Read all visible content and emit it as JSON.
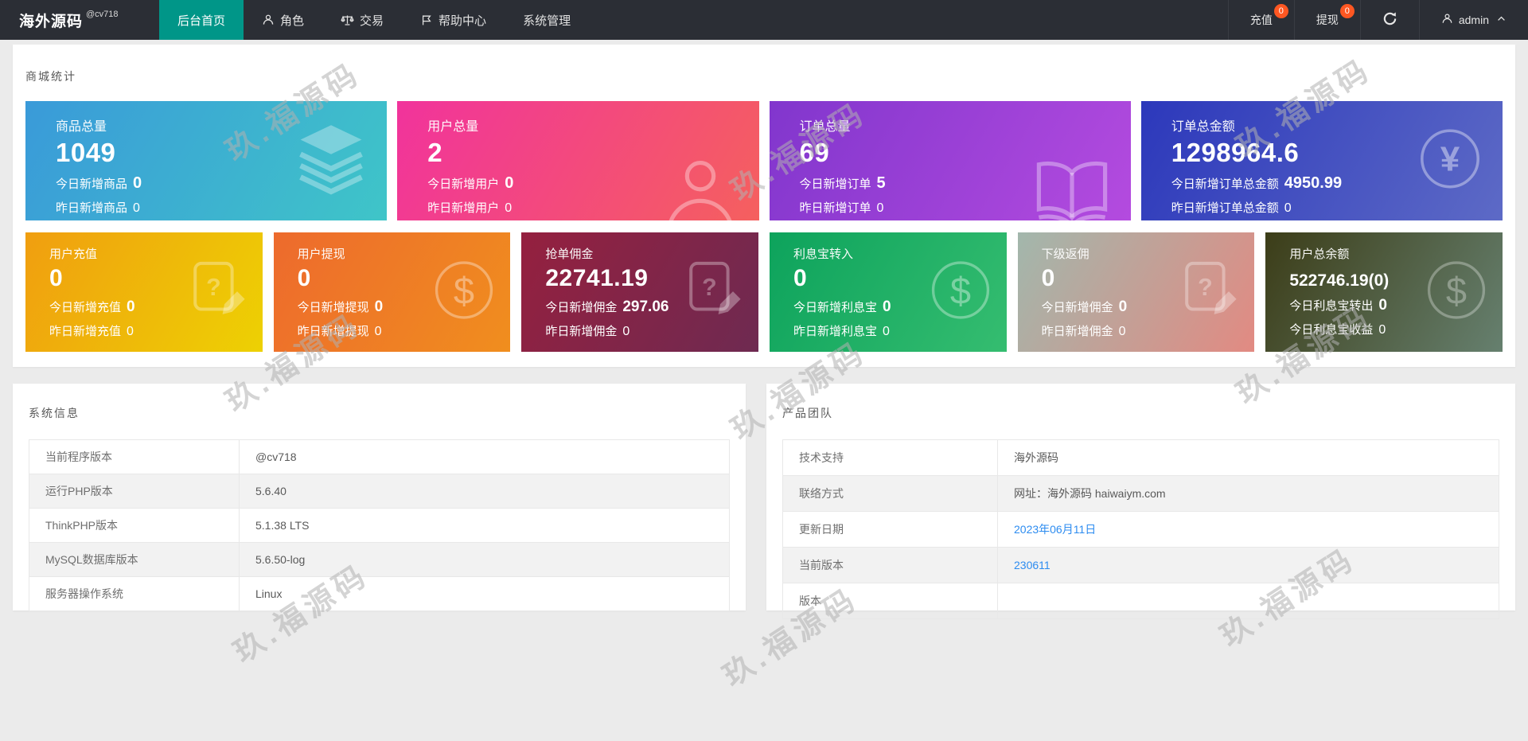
{
  "navbar": {
    "brand": "海外源码",
    "brand_sup": "@cv718",
    "menu": [
      {
        "label": "后台首页",
        "active": true
      },
      {
        "label": "角色",
        "icon": "user-icon"
      },
      {
        "label": "交易",
        "icon": "scales-icon"
      },
      {
        "label": "帮助中心",
        "icon": "flag-icon"
      },
      {
        "label": "系统管理"
      }
    ],
    "right": {
      "recharge": {
        "label": "充值",
        "badge": "0"
      },
      "withdraw": {
        "label": "提现",
        "badge": "0"
      },
      "user": {
        "name": "admin"
      }
    }
  },
  "stats": {
    "section_title": "商城统计",
    "row1": [
      {
        "title": "商品总量",
        "value": "1049",
        "today_label": "今日新增商品",
        "today_value": "0",
        "yesterday_label": "昨日新增商品",
        "yesterday_value": "0",
        "icon": "layers-icon",
        "gradient": [
          "#3a9ad9",
          "#3fc5c8"
        ]
      },
      {
        "title": "用户总量",
        "value": "2",
        "today_label": "今日新增用户",
        "today_value": "0",
        "yesterday_label": "昨日新增用户",
        "yesterday_value": "0",
        "icon": "person-icon",
        "gradient": [
          "#f1339c",
          "#f5605e"
        ]
      },
      {
        "title": "订单总量",
        "value": "69",
        "today_label": "今日新增订单",
        "today_value": "5",
        "yesterday_label": "昨日新增订单",
        "yesterday_value": "0",
        "icon": "book-icon",
        "gradient": [
          "#8136cd",
          "#b44bdf"
        ]
      },
      {
        "title": "订单总金额",
        "value": "1298964.6",
        "today_label": "今日新增订单总金额",
        "today_value": "4950.99",
        "yesterday_label": "昨日新增订单总金额",
        "yesterday_value": "0",
        "icon": "yen-icon",
        "gradient": [
          "#2c38bb",
          "#5d6ac6"
        ]
      }
    ],
    "row2": [
      {
        "title": "用户充值",
        "value": "0",
        "today_label": "今日新增充值",
        "today_value": "0",
        "yesterday_label": "昨日新增充值",
        "yesterday_value": "0",
        "icon": "doc-question-icon",
        "gradient": [
          "#f09e10",
          "#edd103"
        ]
      },
      {
        "title": "用户提现",
        "value": "0",
        "today_label": "今日新增提现",
        "today_value": "0",
        "yesterday_label": "昨日新增提现",
        "yesterday_value": "0",
        "icon": "dollar-icon",
        "gradient": [
          "#ed6a2d",
          "#f08e1e"
        ]
      },
      {
        "title": "抢单佣金",
        "value": "22741.19",
        "today_label": "今日新增佣金",
        "today_value": "297.06",
        "yesterday_label": "昨日新增佣金",
        "yesterday_value": "0",
        "icon": "doc-question-icon",
        "gradient": [
          "#95203f",
          "#6e2a51"
        ]
      },
      {
        "title": "利息宝转入",
        "value": "0",
        "today_label": "今日新增利息宝",
        "today_value": "0",
        "yesterday_label": "昨日新增利息宝",
        "yesterday_value": "0",
        "icon": "dollar-icon",
        "gradient": [
          "#0da35c",
          "#35bd70"
        ]
      },
      {
        "title": "下级返佣",
        "value": "0",
        "today_label": "今日新增佣金",
        "today_value": "0",
        "yesterday_label": "昨日新增佣金",
        "yesterday_value": "0",
        "icon": "doc-question-icon",
        "gradient": [
          "#a2b7ac",
          "#e28a82"
        ]
      },
      {
        "title": "用户总余额",
        "value": "522746.19(0)",
        "today_label": "今日利息宝转出",
        "today_value": "0",
        "yesterday_label": "今日利息宝收益",
        "yesterday_value": "0",
        "icon": "dollar-icon",
        "gradient": [
          "#3c3d18",
          "#66806f"
        ]
      }
    ]
  },
  "system_info": {
    "title": "系统信息",
    "rows": [
      {
        "label": "当前程序版本",
        "value": "@cv718"
      },
      {
        "label": "运行PHP版本",
        "value": "5.6.40"
      },
      {
        "label": "ThinkPHP版本",
        "value": "5.1.38 LTS"
      },
      {
        "label": "MySQL数据库版本",
        "value": "5.6.50-log"
      },
      {
        "label": "服务器操作系统",
        "value": "Linux"
      }
    ]
  },
  "product_team": {
    "title": "产品团队",
    "rows": [
      {
        "label": "技术支持",
        "value": "海外源码"
      },
      {
        "label": "联络方式",
        "value": "网址：海外源码 haiwaiym.com"
      },
      {
        "label": "更新日期",
        "value": "2023年06月11日"
      },
      {
        "label": "当前版本",
        "value": "230611"
      },
      {
        "label": "版本",
        "value": ""
      }
    ]
  },
  "watermark": {
    "text": "玖.福源码"
  },
  "colors": {
    "navbar_bg": "#2b2e35",
    "accent_active": "#009688",
    "badge": "#ff5722",
    "link": "#2d8cf0",
    "body_bg": "#ebebeb",
    "panel_bg": "#ffffff"
  }
}
